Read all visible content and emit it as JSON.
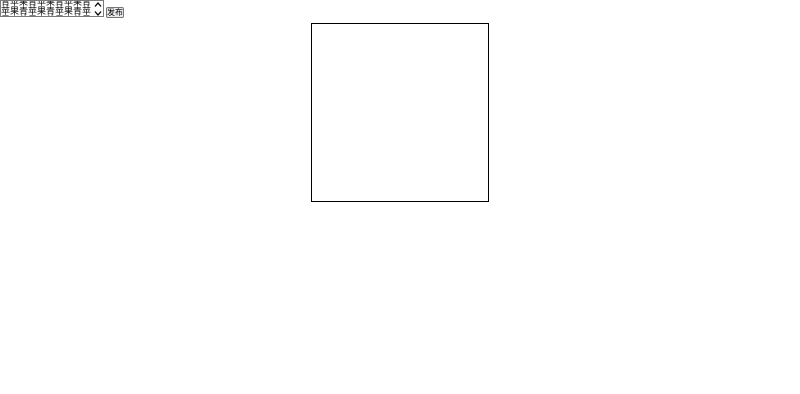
{
  "editor": {
    "text": "青苹果青苹果青苹果青苹果青苹果青苹果青苹果青苹果青苹果青苹果"
  },
  "toolbar": {
    "publish_label": "发布"
  },
  "icons": {
    "scroll_up": "chevron-up-icon",
    "scroll_down": "chevron-down-icon"
  }
}
